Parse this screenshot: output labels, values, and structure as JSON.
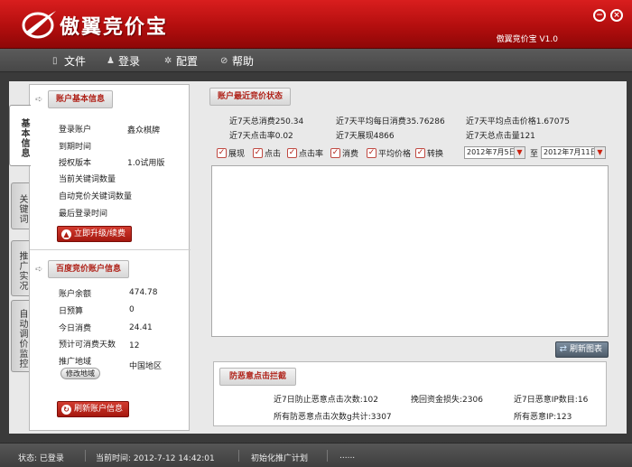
{
  "app": {
    "name": "傲翼竞价宝",
    "version": "傲翼竞价宝 V1.0"
  },
  "menu": [
    {
      "label": "文件",
      "icon": "file-icon"
    },
    {
      "label": "登录",
      "icon": "user-icon"
    },
    {
      "label": "配置",
      "icon": "gear-icon"
    },
    {
      "label": "帮助",
      "icon": "help-icon"
    }
  ],
  "tabs": [
    "基本信息",
    "关键词",
    "推广实况",
    "自动调价监控"
  ],
  "account": {
    "title": "账户基本信息",
    "fields": [
      {
        "label": "登录账户",
        "value": "鑫众棋牌"
      },
      {
        "label": "到期时间",
        "value": ""
      },
      {
        "label": "授权版本",
        "value": "1.0试用版"
      },
      {
        "label": "当前关键词数量",
        "value": ""
      },
      {
        "label": "自动竞价关键词数量",
        "value": ""
      },
      {
        "label": "最后登录时间",
        "value": ""
      }
    ],
    "upgrade_label": "立即升级/续费"
  },
  "baidu": {
    "title": "百度竞价账户信息",
    "fields": [
      {
        "label": "账户余额",
        "value": "474.78"
      },
      {
        "label": "日预算",
        "value": "0"
      },
      {
        "label": "今日消费",
        "value": "24.41"
      },
      {
        "label": "预计可消费天数",
        "value": "12"
      },
      {
        "label": "推广地域",
        "value": "中国地区"
      }
    ],
    "modify_region_label": "修改地域",
    "refresh_label": "刷新账户信息"
  },
  "status": {
    "title": "账户最近竞价状态",
    "stats": [
      "近7天总消费250.34",
      "近7天平均每日消费35.76286",
      "近7天平均点击价格1.67075",
      "近7天点击率0.02",
      "近7天展现4866",
      "近7天总点击量121"
    ],
    "checks": [
      "展现",
      "点击",
      "点击率",
      "消费",
      "平均价格",
      "转换"
    ],
    "date_from": "2012年7月5日",
    "date_sep": "至",
    "date_to": "2012年7月11日",
    "refresh_chart_label": "刷新图表"
  },
  "fraud": {
    "title": "防恶意点击拦截",
    "stats": [
      "近7日防止恶意点击次数:102",
      "挽回资金损失:2306",
      "近7日恶意IP数目:16",
      "所有防恶意点击次数g共计:3307",
      "所有恶意IP:123"
    ]
  },
  "statusbar": {
    "state": "状态: 已登录",
    "time": "当前时间: 2012-7-12 14:42:01",
    "message": "初始化推广计划",
    "progress": "......"
  },
  "colors": {
    "title_red": "#c41414",
    "accent_red": "#b0241b",
    "menubar": "#4f4f4f"
  }
}
